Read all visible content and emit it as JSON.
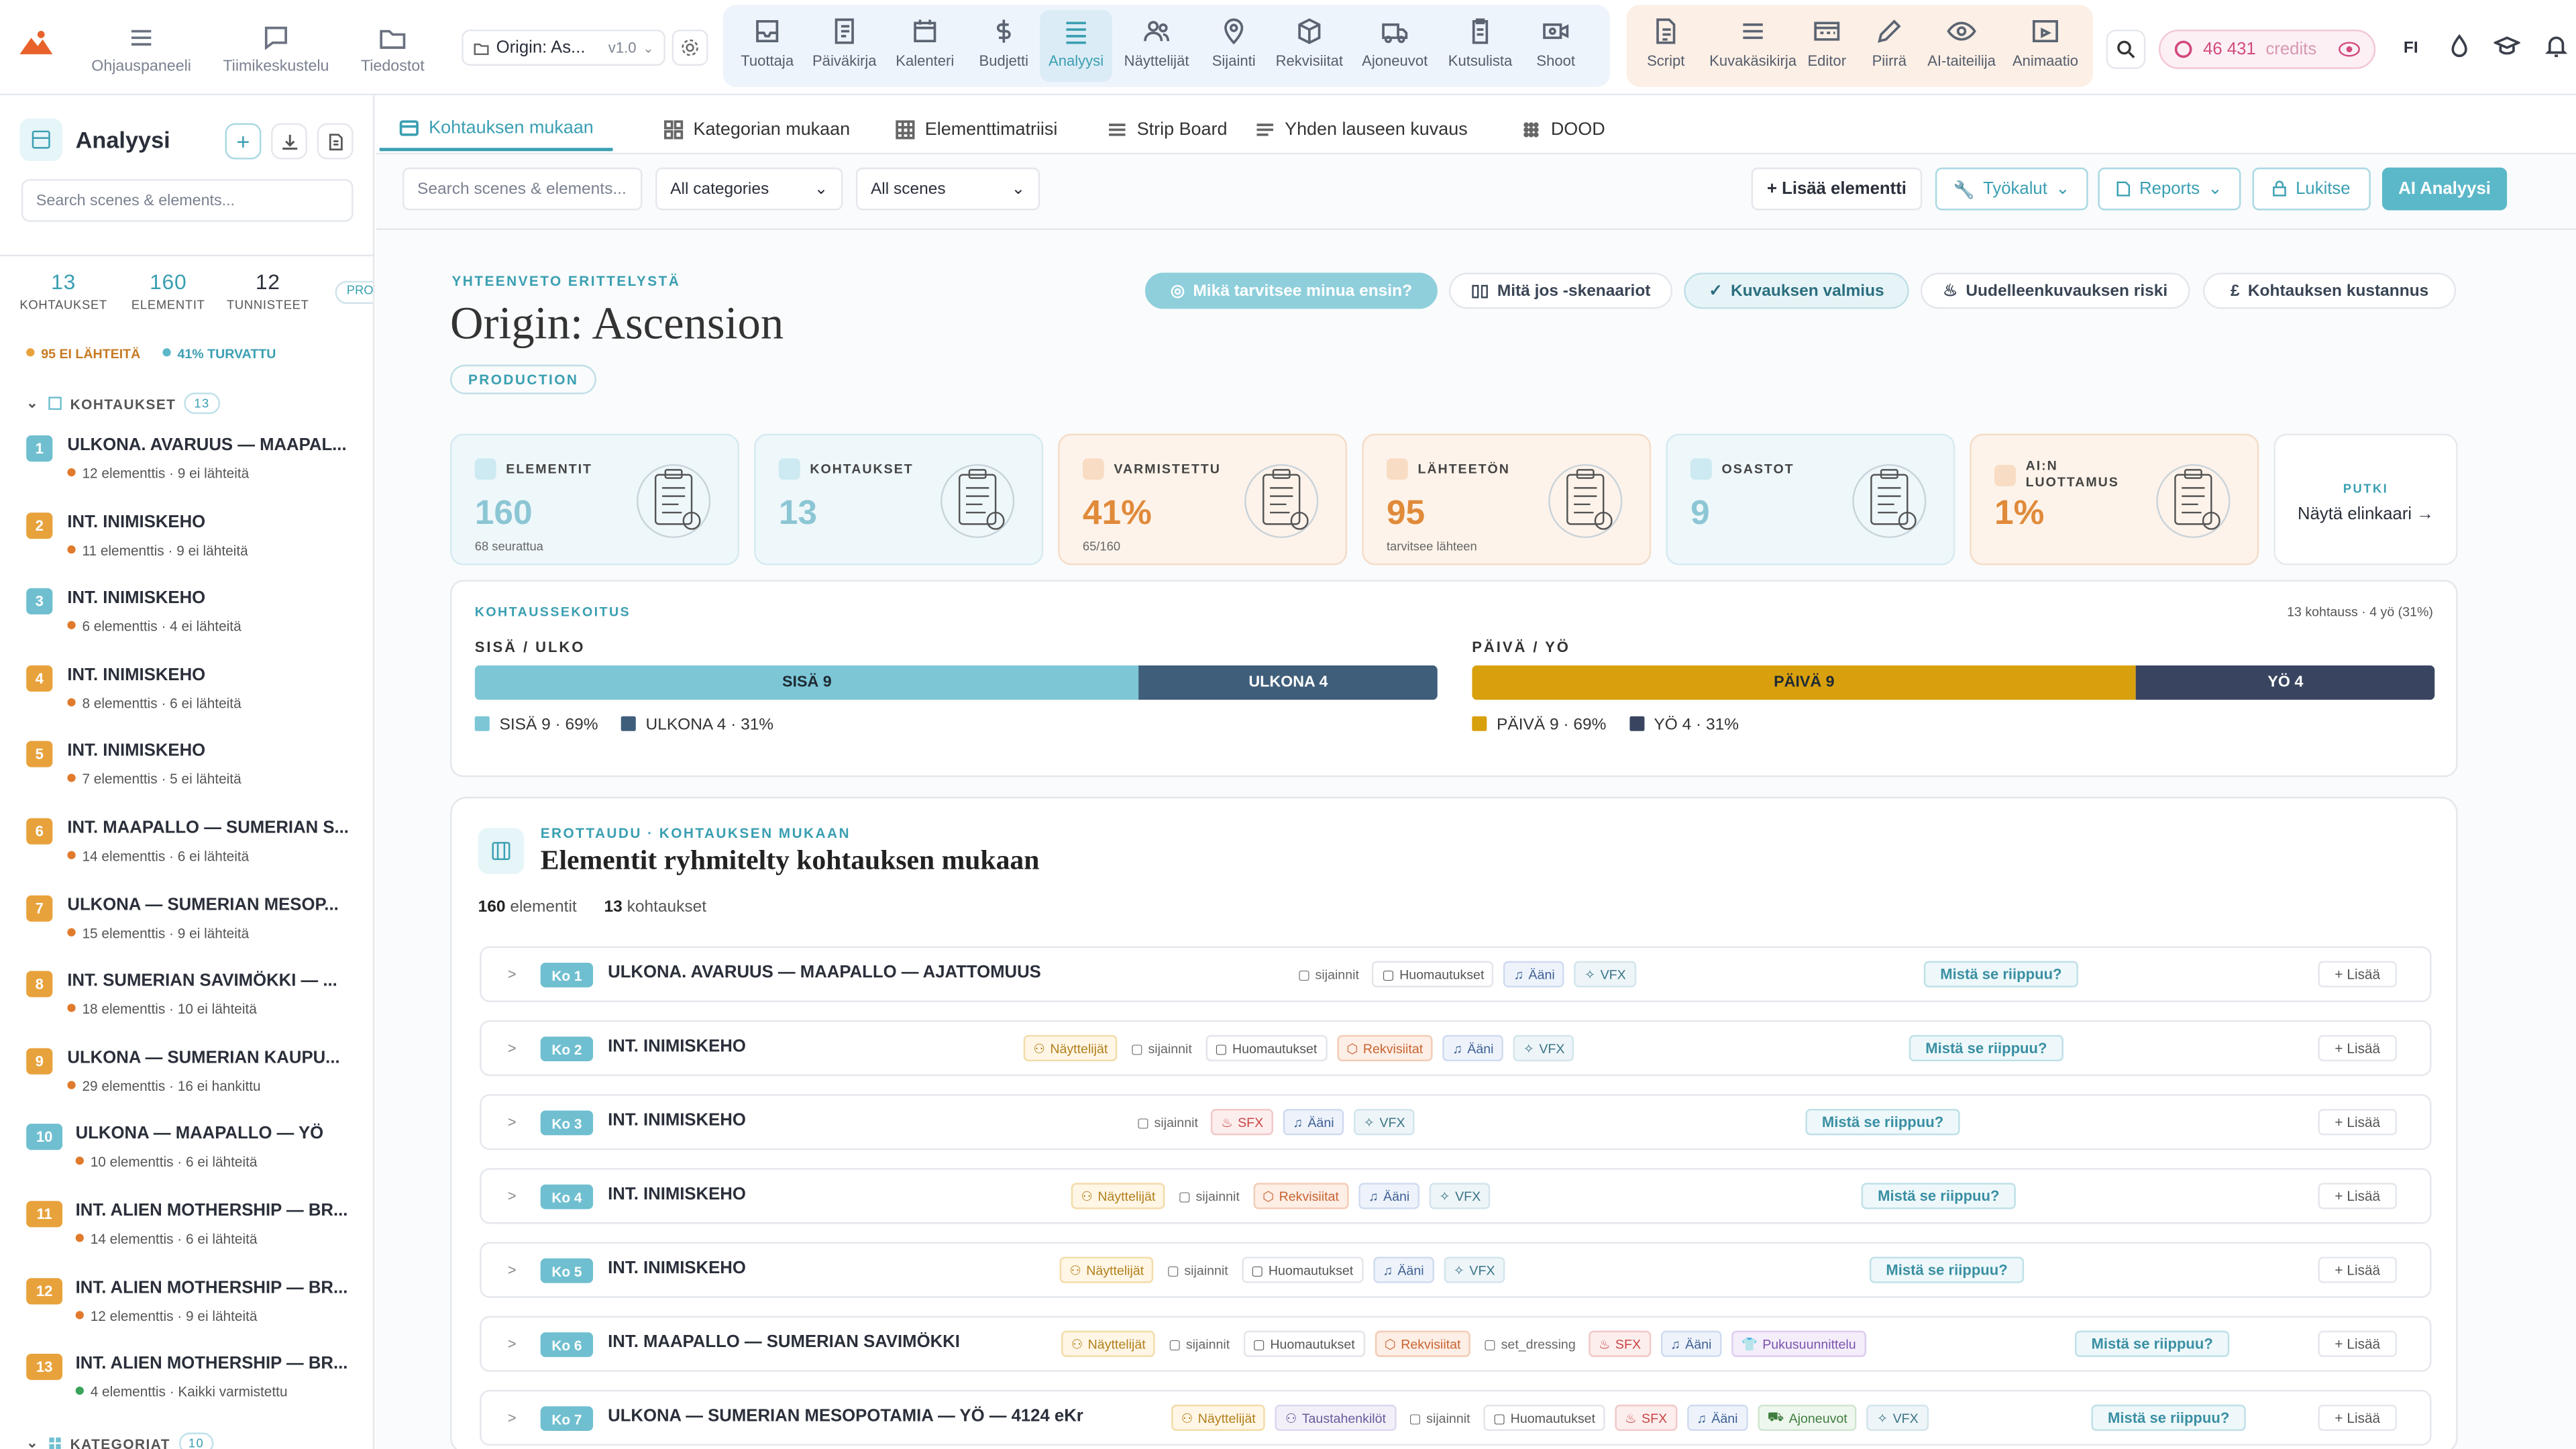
{
  "nav": {
    "left": [
      {
        "label": "Ohjauspaneeli",
        "icon": "menu-icon"
      },
      {
        "label": "Tiimikeskustelu",
        "icon": "chat-icon"
      },
      {
        "label": "Tiedostot",
        "icon": "folder-icon"
      }
    ],
    "project": {
      "name": "Origin: As...",
      "version": "v1.0"
    },
    "main": [
      {
        "label": "Tuottaja",
        "icon": "inbox-icon"
      },
      {
        "label": "Päiväkirja",
        "icon": "journal-icon"
      },
      {
        "label": "Kalenteri",
        "icon": "calendar-icon"
      },
      {
        "label": "Budjetti",
        "icon": "dollar-icon"
      },
      {
        "label": "Analyysi",
        "icon": "analysis-icon"
      },
      {
        "label": "Näyttelijät",
        "icon": "people-icon"
      },
      {
        "label": "Sijainti",
        "icon": "pin-icon"
      },
      {
        "label": "Rekvisiitat",
        "icon": "box-icon"
      },
      {
        "label": "Ajoneuvot",
        "icon": "truck-icon"
      },
      {
        "label": "Kutsulista",
        "icon": "clipboard-icon"
      },
      {
        "label": "Shoot",
        "icon": "camera-icon"
      }
    ],
    "creative": [
      {
        "label": "Script",
        "icon": "script-icon"
      },
      {
        "label": "Kuvakäsikirja",
        "icon": "lines-icon"
      },
      {
        "label": "Editor",
        "icon": "editor-icon"
      },
      {
        "label": "Piirrä",
        "icon": "pencil-icon"
      },
      {
        "label": "AI-taiteilija",
        "icon": "eye-icon"
      },
      {
        "label": "Animaatio",
        "icon": "film-icon"
      }
    ],
    "credits": "46 431",
    "credits_label": "credits",
    "lang": "FI"
  },
  "sidebar": {
    "title": "Analyysi",
    "search_placeholder": "Search scenes & elements...",
    "stats": [
      {
        "value": "13",
        "label": "KOHTAUKSET"
      },
      {
        "value": "160",
        "label": "ELEMENTIT"
      },
      {
        "value": "12",
        "label": "TUNNISTEET"
      }
    ],
    "pro": "PRO",
    "warn_unsourced": "95 EI LÄHTEITÄ",
    "warn_safe": "41% TURVATTU",
    "scenes_header": "KOHTAUKSET",
    "scenes_count": "13",
    "scenes": [
      {
        "n": "1",
        "title": "ULKONA. AVARUUS — MAAPAL...",
        "sub": "12 elementtis · 9 ei lähteitä",
        "color": "#6fbfd0"
      },
      {
        "n": "2",
        "title": "INT. INIMISKEHO",
        "sub": "11 elementtis · 9 ei lähteitä",
        "color": "#e8a23c"
      },
      {
        "n": "3",
        "title": "INT. INIMISKEHO",
        "sub": "6 elementtis · 4 ei lähteitä",
        "color": "#6fbfd0"
      },
      {
        "n": "4",
        "title": "INT. INIMISKEHO",
        "sub": "8 elementtis · 6 ei lähteitä",
        "color": "#e8a23c"
      },
      {
        "n": "5",
        "title": "INT. INIMISKEHO",
        "sub": "7 elementtis · 5 ei lähteitä",
        "color": "#e8a23c"
      },
      {
        "n": "6",
        "title": "INT. MAAPALLO — SUMERIAN S...",
        "sub": "14 elementtis · 6 ei lähteitä",
        "color": "#e8a23c"
      },
      {
        "n": "7",
        "title": "ULKONA — SUMERIAN MESOP...",
        "sub": "15 elementtis · 9 ei lähteitä",
        "color": "#e8a23c"
      },
      {
        "n": "8",
        "title": "INT. SUMERIAN SAVIMÖKKI — ...",
        "sub": "18 elementtis · 10 ei lähteitä",
        "color": "#e8a23c"
      },
      {
        "n": "9",
        "title": "ULKONA — SUMERIAN KAUPU...",
        "sub": "29 elementtis · 16 ei hankittu",
        "color": "#e8a23c"
      },
      {
        "n": "10",
        "title": "ULKONA — MAAPALLO — YÖ",
        "sub": "10 elementtis · 6 ei lähteitä",
        "color": "#6fbfd0"
      },
      {
        "n": "11",
        "title": "INT. ALIEN MOTHERSHIP — BR...",
        "sub": "14 elementtis · 6 ei lähteitä",
        "color": "#e8a23c"
      },
      {
        "n": "12",
        "title": "INT. ALIEN MOTHERSHIP — BR...",
        "sub": "12 elementtis · 9 ei lähteitä",
        "color": "#e8a23c"
      },
      {
        "n": "13",
        "title": "INT. ALIEN MOTHERSHIP — BR...",
        "sub": "4 elementtis · Kaikki varmistettu",
        "color": "#e8a23c",
        "ok": true
      }
    ],
    "categories_header": "KATEGORIAT",
    "categories_count": "10"
  },
  "tabs": [
    {
      "label": "Kohtauksen mukaan",
      "icon": "list-icon"
    },
    {
      "label": "Kategorian mukaan",
      "icon": "grid-icon"
    },
    {
      "label": "Elementtimatriisi",
      "icon": "matrix-icon"
    },
    {
      "label": "Strip Board",
      "icon": "strips-icon"
    },
    {
      "label": "Yhden lauseen kuvaus",
      "icon": "lines-icon"
    },
    {
      "label": "DOOD",
      "icon": "dots-icon"
    }
  ],
  "filters": {
    "search_placeholder": "Search scenes & elements...",
    "category": "All categories",
    "scene": "All scenes",
    "add": "+ Lisää elementti",
    "tools": "Työkalut",
    "reports": "Reports",
    "lock": "Lukitse",
    "ai": "AI Analyysi"
  },
  "summary": {
    "eyebrow": "YHTEENVETO ERITTELYSTÄ",
    "title": "Origin: Ascension",
    "tag": "PRODUCTION",
    "pills": [
      "Mikä tarvitsee minua ensin?",
      "Mitä jos -skenaariot",
      "Kuvauksen valmius",
      "Uudelleenkuvauksen riski",
      "Kohtauksen kustannus"
    ]
  },
  "cards": [
    {
      "title": "ELEMENTIT",
      "value": "160",
      "sub": "68 seurattua",
      "tone": "blue"
    },
    {
      "title": "KOHTAUKSET",
      "value": "13",
      "sub": "",
      "tone": "blue"
    },
    {
      "title": "VARMISTETTU",
      "value": "41%",
      "sub": "65/160",
      "tone": "peach"
    },
    {
      "title": "LÄHTEETÖN",
      "value": "95",
      "sub": "tarvitsee lähteen",
      "tone": "peach"
    },
    {
      "title": "OSASTOT",
      "value": "9",
      "sub": "",
      "tone": "blue"
    },
    {
      "title": "AI:N LUOTTAMUS",
      "value": "1%",
      "sub": "",
      "tone": "peach"
    }
  ],
  "pipeline": {
    "title": "PUTKI",
    "link": "Näytä elinkaari →"
  },
  "mix": {
    "title": "KOHTAUSSEKOITUS",
    "summary": "13 kohtauss · 4 yö (31%)",
    "ie": {
      "label": "SISÄ / ULKO",
      "a_label": "SISÄ 9",
      "a": 0.69,
      "b_label": "ULKONA 4",
      "b": 0.31,
      "leg_a": "SISÄ 9 · 69%",
      "leg_b": "ULKONA 4 · 31%",
      "color_a": "#7cc6d6",
      "color_b": "#3f5e7a"
    },
    "dn": {
      "label": "PÄIVÄ / YÖ",
      "a_label": "PÄIVÄ 9",
      "a": 0.69,
      "b_label": "YÖ 4",
      "b": 0.31,
      "leg_a": "PÄIVÄ 9 · 69%",
      "leg_b": "YÖ 4 · 31%",
      "color_a": "#d9a00d",
      "color_b": "#394560"
    }
  },
  "group": {
    "eyebrow": "EROTTAUDU · KOHTAUKSEN MUKAAN",
    "title": "Elementit ryhmitelty kohtauksen mukaan",
    "count_elements": "160",
    "count_elements_label": "elementit",
    "count_scenes": "13",
    "count_scenes_label": "kohtaukset"
  },
  "rows": [
    {
      "ko": "Ko 1",
      "title": "ULKONA. AVARUUS — MAAPALLO — AJATTOMUUS",
      "tags": [
        [
          "pl",
          "sijainnit"
        ],
        [
          "",
          "Huomautukset"
        ],
        [
          "aa",
          "Ääni"
        ],
        [
          "vx",
          "VFX"
        ]
      ],
      "ask": "Mistä se riippuu?",
      "add": "+ Lisää"
    },
    {
      "ko": "Ko 2",
      "title": "INT. INIMISKEHO",
      "tags": [
        [
          "ny",
          "Näyttelijät"
        ],
        [
          "pl",
          "sijainnit"
        ],
        [
          "",
          "Huomautukset"
        ],
        [
          "rq",
          "Rekvisiitat"
        ],
        [
          "aa",
          "Ääni"
        ],
        [
          "vx",
          "VFX"
        ]
      ],
      "ask": "Mistä se riippuu?",
      "add": "+ Lisää"
    },
    {
      "ko": "Ko 3",
      "title": "INT. INIMISKEHO",
      "tags": [
        [
          "pl",
          "sijainnit"
        ],
        [
          "sx",
          "SFX"
        ],
        [
          "aa",
          "Ääni"
        ],
        [
          "vx",
          "VFX"
        ]
      ],
      "ask": "Mistä se riippuu?",
      "add": "+ Lisää"
    },
    {
      "ko": "Ko 4",
      "title": "INT. INIMISKEHO",
      "tags": [
        [
          "ny",
          "Näyttelijät"
        ],
        [
          "pl",
          "sijainnit"
        ],
        [
          "rq",
          "Rekvisiitat"
        ],
        [
          "aa",
          "Ääni"
        ],
        [
          "vx",
          "VFX"
        ]
      ],
      "ask": "Mistä se riippuu?",
      "add": "+ Lisää"
    },
    {
      "ko": "Ko 5",
      "title": "INT. INIMISKEHO",
      "tags": [
        [
          "ny",
          "Näyttelijät"
        ],
        [
          "pl",
          "sijainnit"
        ],
        [
          "",
          "Huomautukset"
        ],
        [
          "aa",
          "Ääni"
        ],
        [
          "vx",
          "VFX"
        ]
      ],
      "ask": "Mistä se riippuu?",
      "add": "+ Lisää"
    },
    {
      "ko": "Ko 6",
      "title": "INT. MAAPALLO — SUMERIAN SAVIMÖKKI",
      "tags": [
        [
          "ny",
          "Näyttelijät"
        ],
        [
          "pl",
          "sijainnit"
        ],
        [
          "",
          "Huomautukset"
        ],
        [
          "rq",
          "Rekvisiitat"
        ],
        [
          "pl",
          "set_dressing"
        ],
        [
          "sx",
          "SFX"
        ],
        [
          "aa",
          "Ääni"
        ],
        [
          "pk",
          "Pukusuunnittelu"
        ]
      ],
      "ask": "Mistä se riippuu?",
      "add": "+ Lisää"
    },
    {
      "ko": "Ko 7",
      "title": "ULKONA — SUMERIAN MESOPOTAMIA — YÖ — 4124 eKr",
      "tags": [
        [
          "ny",
          "Näyttelijät"
        ],
        [
          "th",
          "Taustahenkilöt"
        ],
        [
          "pl",
          "sijainnit"
        ],
        [
          "",
          "Huomautukset"
        ],
        [
          "sx",
          "SFX"
        ],
        [
          "aa",
          "Ääni"
        ],
        [
          "av",
          "Ajoneuvot"
        ],
        [
          "vx",
          "VFX"
        ]
      ],
      "ask": "Mistä se riippuu?",
      "add": "+ Lisää"
    }
  ]
}
